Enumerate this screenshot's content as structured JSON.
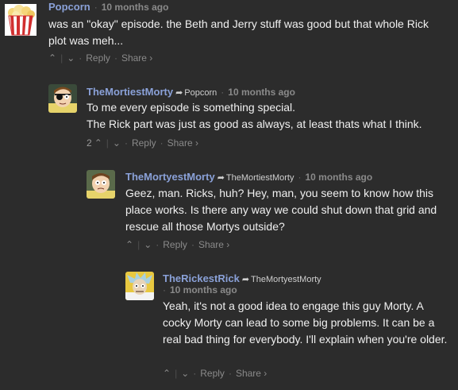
{
  "comments": [
    {
      "author": "Popcorn",
      "reply_to": "",
      "time": "10 months ago",
      "body": [
        "was an \"okay\" episode. the Beth and Jerry stuff was good but that whole Rick plot was meh..."
      ],
      "vote_count": "",
      "reply_label": "Reply",
      "share_label": "Share ›"
    },
    {
      "author": "TheMortiestMorty",
      "reply_to": "Popcorn",
      "time": "10 months ago",
      "body": [
        "To me every episode is something special.",
        "The Rick part was just as good as always, at least thats what I think."
      ],
      "vote_count": "2",
      "reply_label": "Reply",
      "share_label": "Share ›"
    },
    {
      "author": "TheMortyestMorty",
      "reply_to": "TheMortiestMorty",
      "time": "10 months ago",
      "body": [
        "Geez, man. Ricks, huh? Hey, man, you seem to know how this place works. Is there any way we could shut down that grid and rescue all those Mortys outside?"
      ],
      "vote_count": "",
      "reply_label": "Reply",
      "share_label": "Share ›"
    },
    {
      "author": "TheRickestRick",
      "reply_to": "TheMortyestMorty",
      "time": "10 months ago",
      "body": [
        "Yeah, it's not a good idea to engage this guy Morty. A cocky Morty can lead to some big problems. It can be a real bad thing for everybody. I'll explain when you're older."
      ],
      "vote_count": "",
      "reply_label": "Reply",
      "share_label": "Share ›"
    }
  ],
  "glyphs": {
    "upvote": "⌃",
    "downvote": "⌄",
    "reply_arrow": "➦",
    "dot": "·"
  },
  "colors": {
    "background": "#2c2c2c",
    "author": "#8aa1d8",
    "meta": "#8a8a8a"
  }
}
